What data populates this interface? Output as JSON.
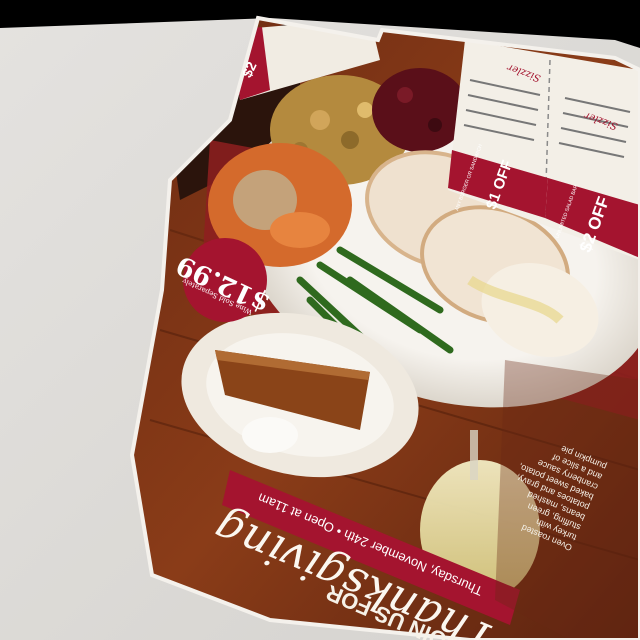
{
  "flyer": {
    "headline_top": "JOIN US FOR",
    "headline_script": "Thanksgiving",
    "date_banner": "Thursday, November 24th • Open at 11am",
    "price_badge": {
      "amount": "$12.99",
      "dollar": "$",
      "whole": "12",
      "cents": "99",
      "sub": "Wine Sold Separately"
    },
    "menu_blurb": [
      "Oven roasted",
      "turkey with",
      "stuffing, green",
      "beans, mashed",
      "potatoes and gravy,",
      "baked sweet potato,",
      "cranberry sauce",
      "and a slice of",
      "pumpkin pie"
    ],
    "coupon_left": {
      "brand": "Sizzler",
      "amount": "$1 OFF",
      "sub": "ANY BURGER OR SANDWICH"
    },
    "coupon_right": {
      "brand": "Sizzler",
      "amount": "$2 OFF",
      "sub": "UNLIMITED SALAD BAR"
    },
    "coupon_corner": {
      "amount": "$2"
    }
  },
  "colors": {
    "brand_red": "#a4142f",
    "cream": "#f3efe7",
    "wall": "#e0deda"
  }
}
